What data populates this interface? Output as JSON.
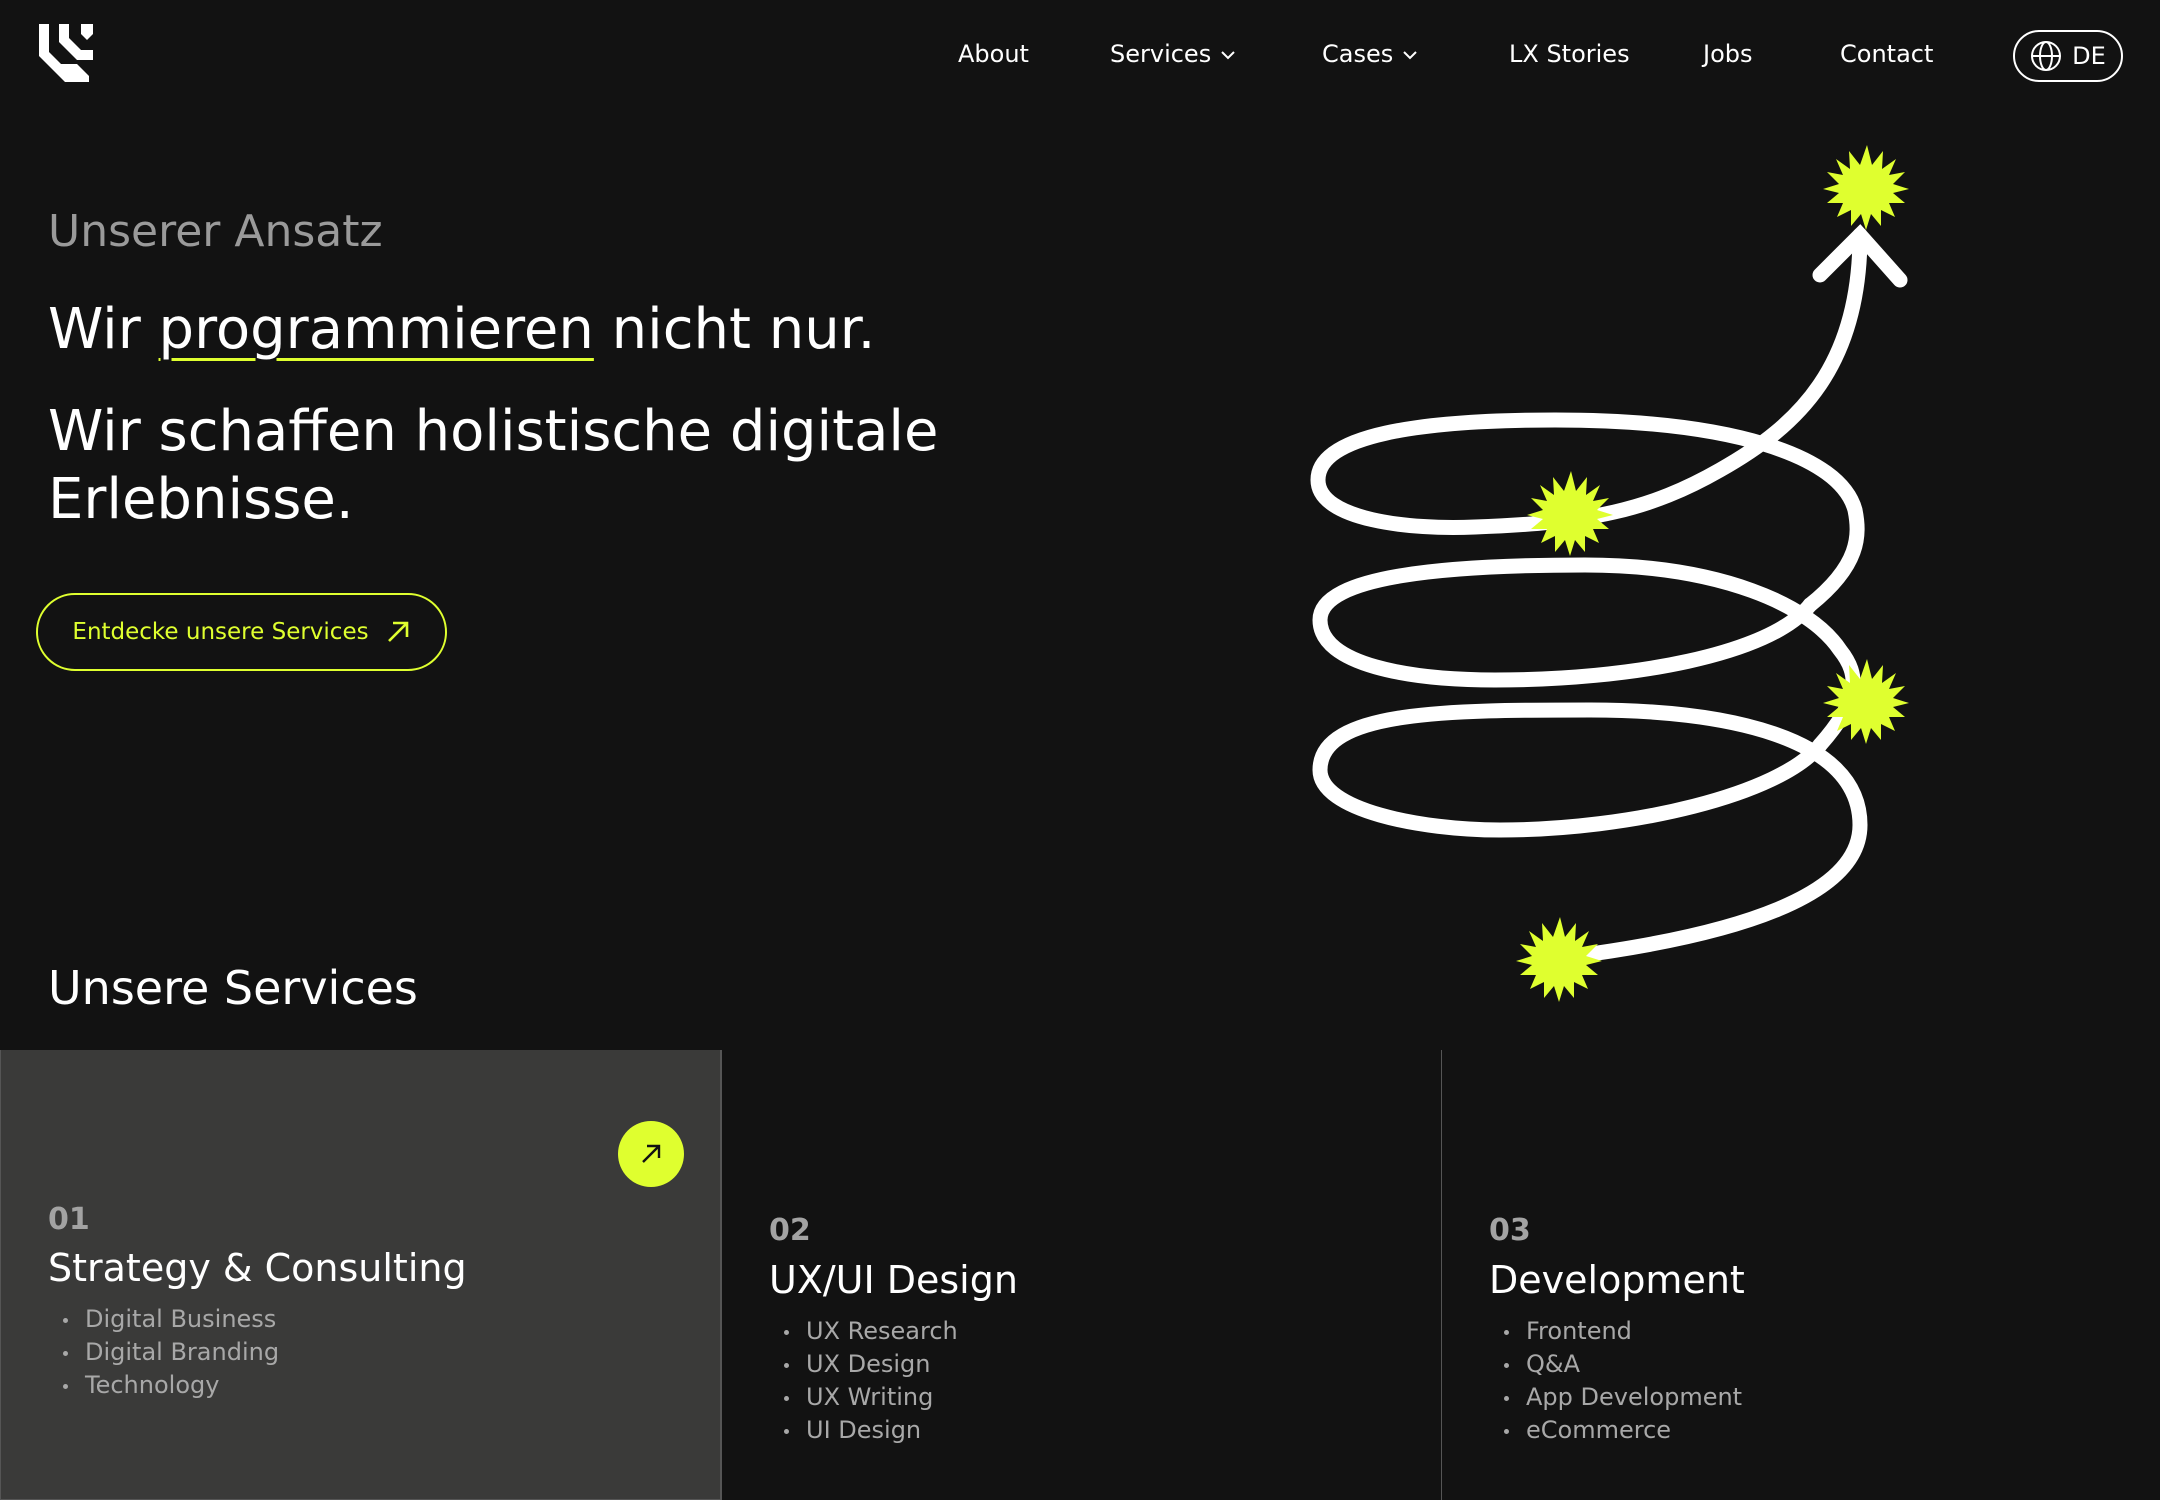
{
  "header": {
    "logo_name": "lx-logo",
    "nav": [
      {
        "label": "About",
        "has_dropdown": false
      },
      {
        "label": "Services",
        "has_dropdown": true
      },
      {
        "label": "Cases",
        "has_dropdown": true
      },
      {
        "label": "LX Stories",
        "has_dropdown": false
      },
      {
        "label": "Jobs",
        "has_dropdown": false
      },
      {
        "label": "Contact",
        "has_dropdown": false
      }
    ],
    "language": {
      "label": "DE",
      "icon": "globe-icon"
    }
  },
  "hero": {
    "eyebrow": "Unserer Ansatz",
    "line1_before": "Wir ",
    "line1_emphasis": "programmieren",
    "line1_after": " nicht nur.",
    "line2": "Wir schaffen holistische digitale Erlebnisse.",
    "cta_label": "Entdecke unsere Services",
    "cta_icon": "arrow-up-right-icon"
  },
  "services": {
    "heading": "Unsere Services",
    "cards": [
      {
        "number": "01",
        "title": "Strategy & Consulting",
        "items": [
          "Digital Business",
          "Digital Branding",
          "Technology"
        ],
        "highlighted": true
      },
      {
        "number": "02",
        "title": "UX/UI Design",
        "items": [
          "UX Research",
          "UX Design",
          "UX Writing",
          "UI Design"
        ],
        "highlighted": false
      },
      {
        "number": "03",
        "title": "Development",
        "items": [
          "Frontend",
          "Q&A",
          "App Development",
          "eCommerce"
        ],
        "highlighted": false
      }
    ]
  },
  "colors": {
    "background": "#121212",
    "accent": "#dfff2f",
    "card_highlight": "#3a3a39",
    "muted_text": "#9a9a9a"
  }
}
